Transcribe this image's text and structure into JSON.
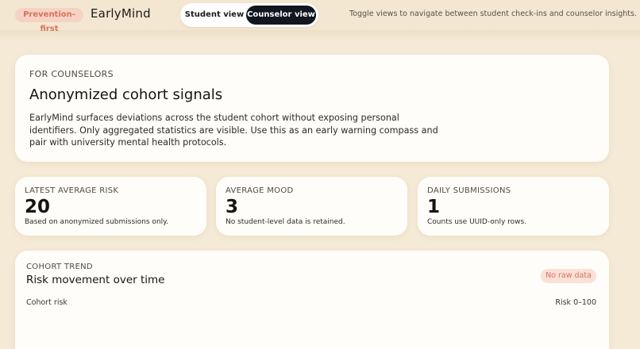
{
  "header": {
    "tag": "Prevention-first",
    "brand": "EarlyMind",
    "views": {
      "student": "Student view",
      "counselor": "Counselor view",
      "active": "counselor"
    },
    "hint": "Toggle views to navigate between student check-ins and counselor insights."
  },
  "hero": {
    "eyebrow": "FOR COUNSELORS",
    "title": "Anonymized cohort signals",
    "description": "EarlyMind surfaces deviations across the student cohort without exposing personal identifiers. Only aggregated statistics are visible. Use this as an early warning compass and pair with university mental health protocols."
  },
  "stats": [
    {
      "label": "LATEST AVERAGE RISK",
      "value": "20",
      "note": "Based on anonymized submissions only."
    },
    {
      "label": "AVERAGE MOOD",
      "value": "3",
      "note": "No student-level data is retained."
    },
    {
      "label": "DAILY SUBMISSIONS",
      "value": "1",
      "note": "Counts use UUID-only rows."
    }
  ],
  "trend": {
    "eyebrow": "COHORT TREND",
    "title": "Risk movement over time",
    "badge": "No raw data",
    "series_label": "Cohort risk",
    "range_label": "Risk 0–100"
  },
  "colors": {
    "background": "#f5ead6",
    "card": "#fffdf9",
    "accent": "#d8735b",
    "tag_bg": "#f6d2c4",
    "toggle_active": "#11161f"
  }
}
